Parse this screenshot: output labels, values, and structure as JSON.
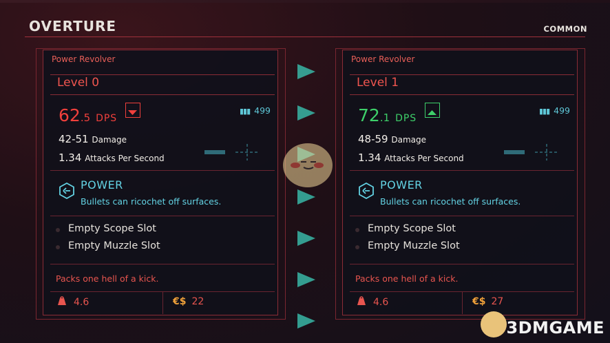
{
  "header": {
    "title": "OVERTURE",
    "rarity": "COMMON"
  },
  "cards": [
    {
      "name": "Power Revolver",
      "level": "Level 0",
      "dps_int": "62",
      "dps_dec": ".5",
      "dps_unit": "DPS",
      "dps_trend": "down",
      "dps_color": "#f0403c",
      "ammo": "499",
      "damage_value": "42-51",
      "damage_label": "Damage",
      "aps_value": "1.34",
      "aps_label": "Attacks Per Second",
      "mod_title": "POWER",
      "mod_desc": "Bullets can ricochet off surfaces.",
      "slots": [
        "Empty Scope Slot",
        "Empty Muzzle Slot"
      ],
      "flavor": "Packs one hell of a kick.",
      "weight": "4.6",
      "price": "22",
      "currency": "€$"
    },
    {
      "name": "Power Revolver",
      "level": "Level 1",
      "dps_int": "72",
      "dps_dec": ".1",
      "dps_unit": "DPS",
      "dps_trend": "up",
      "dps_color": "#3ed06a",
      "ammo": "499",
      "damage_value": "48-59",
      "damage_label": "Damage",
      "aps_value": "1.34",
      "aps_label": "Attacks Per Second",
      "mod_title": "POWER",
      "mod_desc": "Bullets can ricochet off surfaces.",
      "slots": [
        "Empty Scope Slot",
        "Empty Muzzle Slot"
      ],
      "flavor": "Packs one hell of a kick.",
      "weight": "4.6",
      "price": "27",
      "currency": "€$"
    }
  ],
  "watermark": {
    "text": "3DMGAME"
  },
  "colors": {
    "accent_red": "#e8554f",
    "accent_cyan": "#63d2e3",
    "accent_gold": "#f0a13a",
    "arrow_teal": "#38b6a6"
  },
  "icons": [
    "arrow-down-icon",
    "arrow-up-icon",
    "ammo-icon",
    "scope-reticle-icon",
    "tech-mod-icon",
    "weight-icon",
    "comparison-arrow-icon"
  ]
}
